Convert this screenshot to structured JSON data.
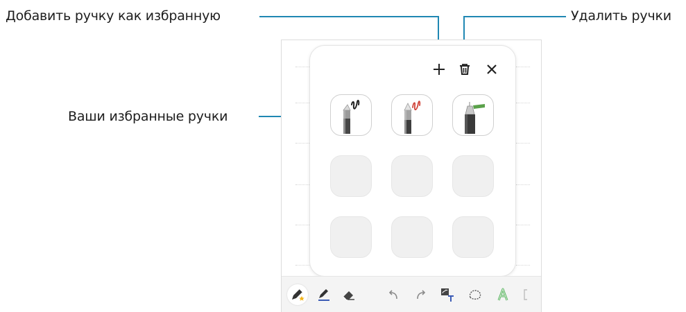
{
  "callouts": {
    "add_favorite": "Добавить ручку как избранную",
    "delete_pens": "Удалить ручки",
    "favorite_pens": "Ваши избранные ручки"
  },
  "panel": {
    "icons": [
      "plus-icon",
      "trash-icon",
      "close-icon"
    ],
    "favorite_pens": [
      {
        "name": "pencil-pen",
        "stroke_color": "#222222"
      },
      {
        "name": "red-pen",
        "stroke_color": "#d0443a"
      },
      {
        "name": "fountain-highlighter-pen",
        "stroke_color": "#5aa14a"
      }
    ],
    "empty_slots": 6
  },
  "toolbar": {
    "icons": [
      "pen-favorite-icon",
      "pen-icon",
      "eraser-icon",
      "undo-icon",
      "redo-icon",
      "text-convert-icon",
      "lasso-icon",
      "text-style-icon",
      "more-icon"
    ]
  },
  "colors": {
    "callout_line": "#1f87b3",
    "accent_star": "#f2b41a",
    "text_style_green": "#5bb463"
  }
}
